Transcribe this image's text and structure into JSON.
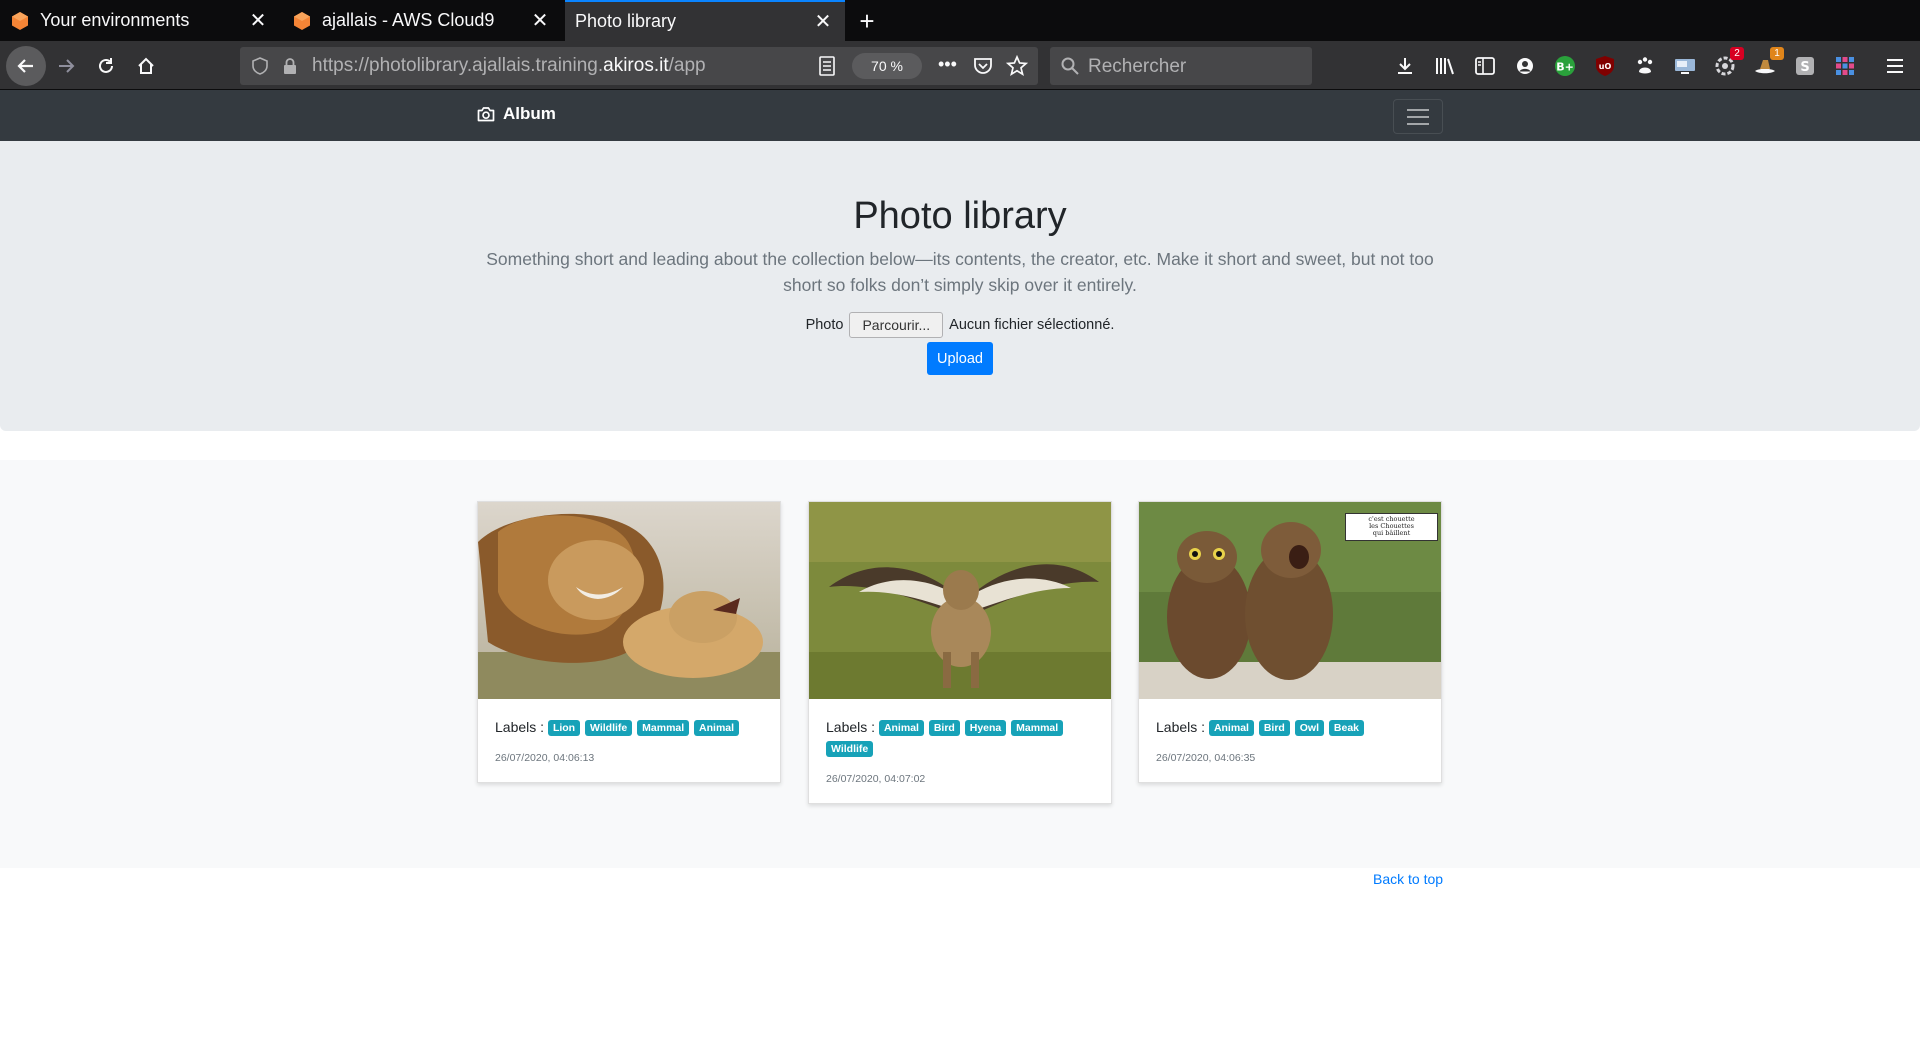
{
  "browser": {
    "tabs": [
      {
        "title": "Your environments"
      },
      {
        "title": "ajallais - AWS Cloud9"
      },
      {
        "title": "Photo library"
      }
    ],
    "url_prefix": "https://photolibrary.ajallais.training.",
    "url_host": "akiros.it",
    "url_path": "/app",
    "zoom": "70 %",
    "search_placeholder": "Rechercher",
    "badges": {
      "ext1": "2",
      "ext2": "1"
    }
  },
  "site": {
    "brand": "Album",
    "hero": {
      "title": "Photo library",
      "lead": "Something short and leading about the collection below—its contents, the creator, etc. Make it short and sweet, but not too short so folks don’t simply skip over it entirely.",
      "photo_label": "Photo",
      "browse_label": "Parcourir...",
      "no_file": "Aucun fichier sélectionné.",
      "upload_label": "Upload"
    },
    "cards": [
      {
        "labels_title": "Labels :",
        "labels": [
          "Lion",
          "Wildlife",
          "Mammal",
          "Animal"
        ],
        "timestamp": "26/07/2020, 04:06:13"
      },
      {
        "labels_title": "Labels :",
        "labels": [
          "Animal",
          "Bird",
          "Hyena",
          "Mammal",
          "Wildlife"
        ],
        "timestamp": "26/07/2020, 04:07:02"
      },
      {
        "labels_title": "Labels :",
        "labels": [
          "Animal",
          "Bird",
          "Owl",
          "Beak"
        ],
        "timestamp": "26/07/2020, 04:06:35",
        "image_caption": [
          "c'est chouette",
          "les Chouettes",
          "qui bâillent"
        ]
      }
    ],
    "back_to_top": "Back to top"
  }
}
